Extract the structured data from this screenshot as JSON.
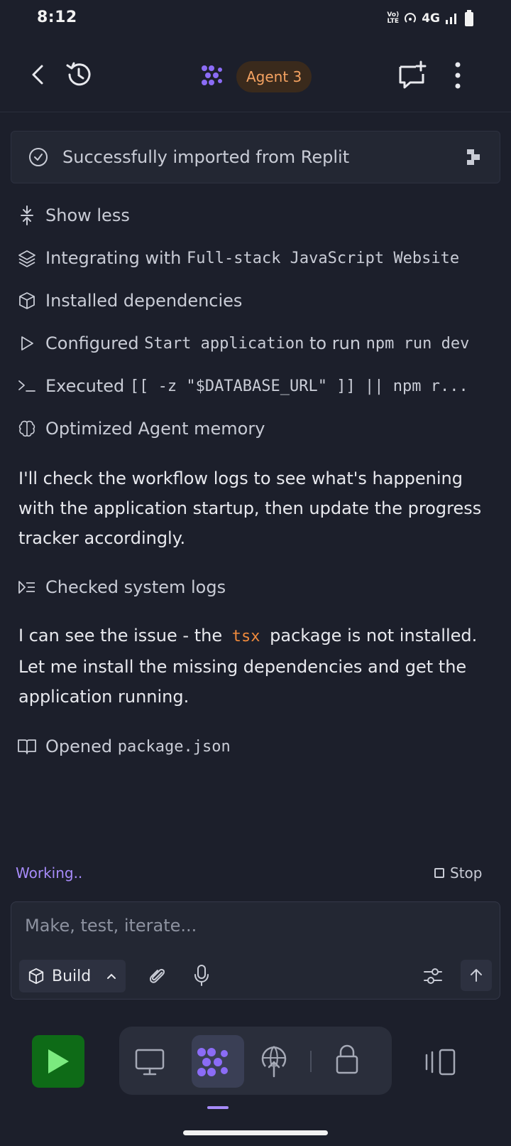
{
  "status_bar": {
    "time": "8:12",
    "network": "4G",
    "volte_top": "Vo)",
    "volte_bottom": "LTE"
  },
  "header": {
    "agent_label": "Agent 3"
  },
  "banner": {
    "text": "Successfully imported from Replit"
  },
  "activity": {
    "show_less": "Show less",
    "integrating_prefix": "Integrating with",
    "integrating_code": "Full-stack JavaScript Website",
    "installed": "Installed dependencies",
    "configured_prefix": "Configured",
    "configured_code": "Start application",
    "configured_mid": "to run",
    "configured_cmd": "npm run dev",
    "executed_prefix": "Executed",
    "executed_code": "[[ -z \"$DATABASE_URL\" ]] || npm r...",
    "optimized": "Optimized Agent memory",
    "message1": "I'll check the workflow logs to see what's happening with the application startup, then update the progress tracker accordingly.",
    "checked_logs": "Checked system logs",
    "message2_before": "I can see the issue - the",
    "message2_code": "tsx",
    "message2_after": "package is not installed. Let me install the missing dependencies and get the application running.",
    "opened_prefix": "Opened",
    "opened_code": "package.json"
  },
  "status": {
    "working": "Working..",
    "stop": "Stop"
  },
  "composer": {
    "placeholder": "Make, test, iterate...",
    "mode": "Build"
  },
  "colors": {
    "accent": "#a78bfa",
    "agent_pill_text": "#f4a261",
    "run_green": "#0e6b17",
    "code_orange": "#f08a3c"
  }
}
